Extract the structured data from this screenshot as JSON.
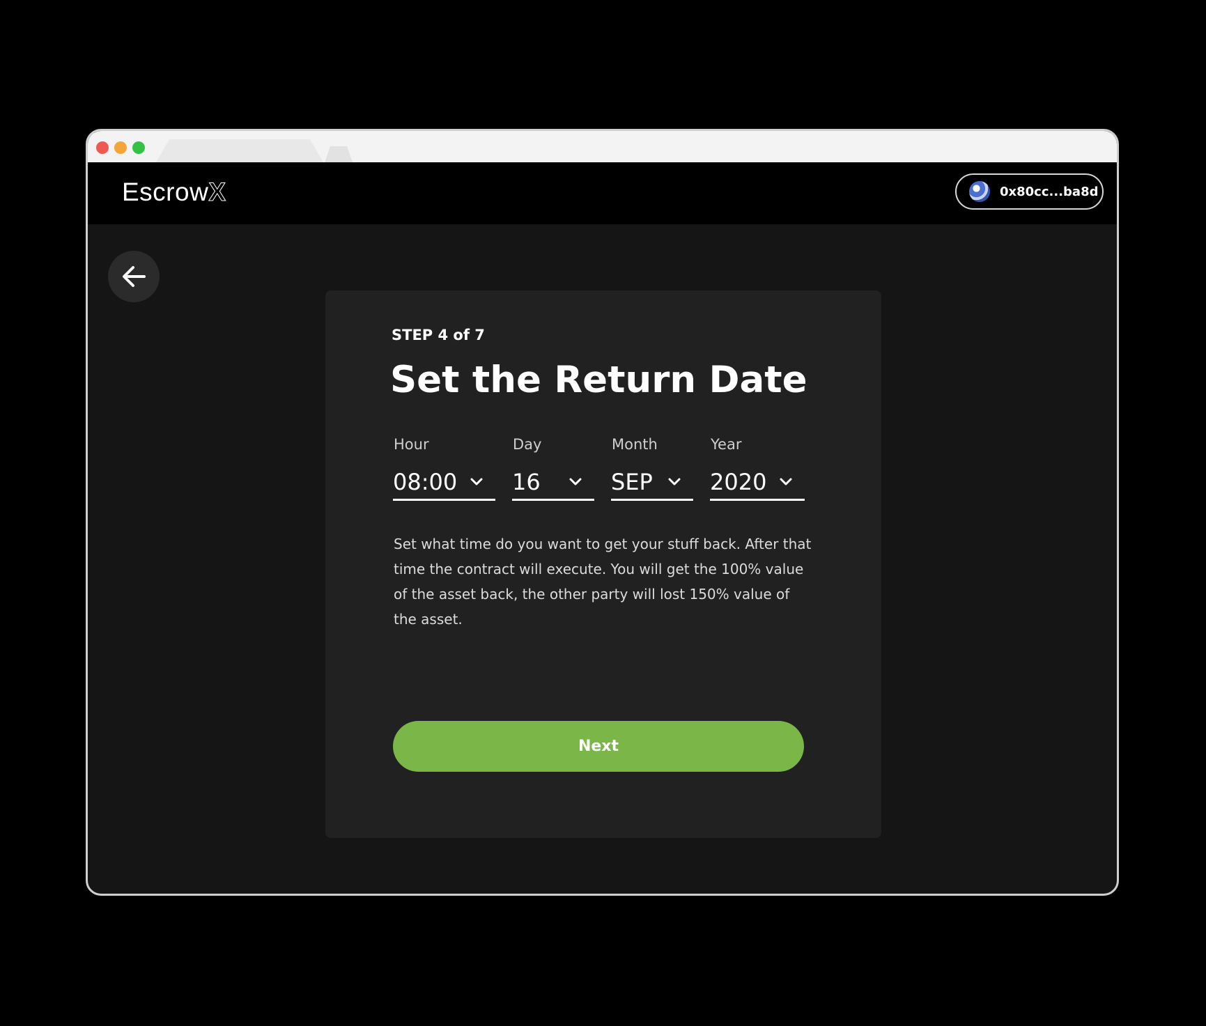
{
  "brand": {
    "name": "Escrow",
    "mark": "X"
  },
  "wallet": {
    "address": "0x80cc...ba8d",
    "icon": "wallet-avatar-icon"
  },
  "navigation": {
    "back_icon": "arrow-left-icon"
  },
  "form": {
    "step": "STEP 4 of 7",
    "title": "Set the Return Date",
    "fields": [
      {
        "label": "Hour",
        "value": "08:00"
      },
      {
        "label": "Day",
        "value": "16"
      },
      {
        "label": "Month",
        "value": "SEP"
      },
      {
        "label": "Year",
        "value": "2020"
      }
    ],
    "description": "Set what time do you want to get your stuff back. After that time the contract will execute. You will get the 100% value of the asset back, the other party will lost 150% value of the asset.",
    "next_label": "Next"
  },
  "colors": {
    "accent": "#7ab648",
    "background": "#151515",
    "card": "#212121"
  }
}
